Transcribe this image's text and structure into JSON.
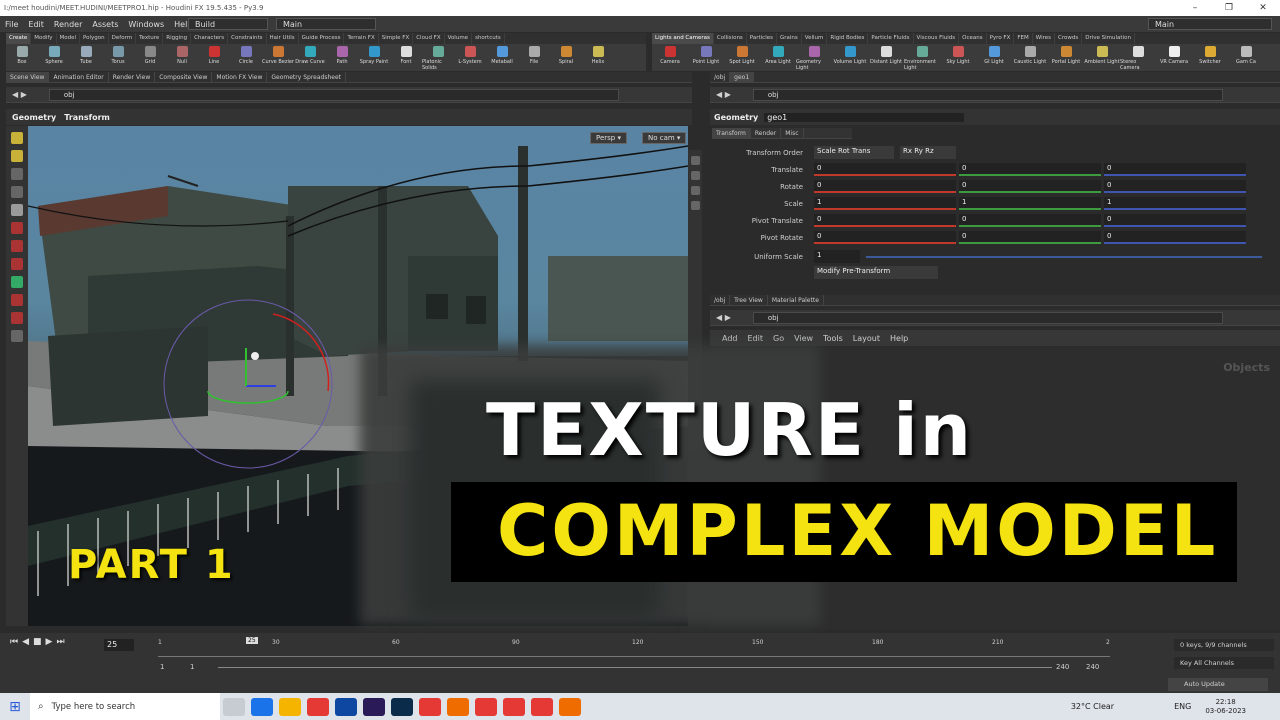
{
  "window": {
    "title": "I:/meet houdini/MEET.HUDINI/MEETPRO1.hip - Houdini FX 19.5.435 - Py3.9"
  },
  "menu": [
    "File",
    "Edit",
    "Render",
    "Assets",
    "Windows",
    "Help"
  ],
  "desktops": {
    "left": "Build",
    "middle": "Main",
    "right": "Main"
  },
  "shelf_tabs_left": [
    "Create",
    "Modify",
    "Model",
    "Polygon",
    "Deform",
    "Texture",
    "Rigging",
    "Characters",
    "Constraints",
    "Hair Utils",
    "Guide Process",
    "Terrain FX",
    "Simple FX",
    "Cloud FX",
    "Volume",
    "shortcuts"
  ],
  "shelf_tabs_right": [
    "Lights and Cameras",
    "Collisions",
    "Particles",
    "Grains",
    "Vellum",
    "Rigid Bodies",
    "Particle Fluids",
    "Viscous Fluids",
    "Oceans",
    "Pyro FX",
    "FEM",
    "Wires",
    "Crowds",
    "Drive Simulation"
  ],
  "tools_left": [
    "Box",
    "Sphere",
    "Tube",
    "Torus",
    "Grid",
    "Null",
    "Line",
    "Circle",
    "Curve Bezier",
    "Draw Curve",
    "Path",
    "Spray Paint",
    "Font",
    "Platonic Solids",
    "L-System",
    "Metaball",
    "File",
    "Spiral",
    "Helix"
  ],
  "tools_right": [
    "Camera",
    "Point Light",
    "Spot Light",
    "Area Light",
    "Geometry Light",
    "Volume Light",
    "Distant Light",
    "Environment Light",
    "Sky Light",
    "GI Light",
    "Caustic Light",
    "Portal Light",
    "Ambient Light",
    "Stereo Camera",
    "VR Camera",
    "Switcher",
    "Gam Ca"
  ],
  "left_pane_tabs": [
    "Scene View",
    "Animation Editor",
    "Render View",
    "Composite View",
    "Motion FX View",
    "Geometry Spreadsheet"
  ],
  "left_path": "obj",
  "viewer_header": {
    "ctx": "Geometry",
    "tool": "Transform"
  },
  "viewport_buttons": {
    "persp": "Persp ▾",
    "cam": "No cam ▾"
  },
  "right_top_tabs": [
    "/obj",
    "geo1"
  ],
  "right_path": "obj",
  "node": {
    "type": "Geometry",
    "name": "geo1"
  },
  "param_tabs": [
    "Transform",
    "Render",
    "Misc"
  ],
  "transform_order": {
    "label": "Transform Order",
    "order": "Scale Rot Trans",
    "rot": "Rx Ry Rz"
  },
  "params": [
    {
      "label": "Translate",
      "x": "0",
      "y": "0",
      "z": "0"
    },
    {
      "label": "Rotate",
      "x": "0",
      "y": "0",
      "z": "0"
    },
    {
      "label": "Scale",
      "x": "1",
      "y": "1",
      "z": "1"
    },
    {
      "label": "Pivot Translate",
      "x": "0",
      "y": "0",
      "z": "0"
    },
    {
      "label": "Pivot Rotate",
      "x": "0",
      "y": "0",
      "z": "0"
    }
  ],
  "uniform_scale": {
    "label": "Uniform Scale",
    "value": "1"
  },
  "modify_pre": "Modify Pre-Transform",
  "net_tabs": [
    "/obj",
    "Tree View",
    "Material Palette"
  ],
  "net_path": "obj",
  "net_menu": [
    "Add",
    "Edit",
    "Go",
    "View",
    "Tools",
    "Layout",
    "Help"
  ],
  "net_watermark": "Objects",
  "overlay": {
    "line1": "TEXTURE in",
    "line2": "COMPLEX MODEL",
    "part": "PART 1"
  },
  "timeline": {
    "frame": "25",
    "ticks": [
      "1",
      "30",
      "60",
      "90",
      "120",
      "150",
      "180",
      "210",
      "2"
    ],
    "start": "1",
    "start2": "1",
    "end": "240",
    "end2": "240",
    "keys": "0 keys, 9/9 channels",
    "keyall": "Key All Channels",
    "auto": "Auto Update",
    "current": "25"
  },
  "taskbar": {
    "search": "Type here to search",
    "weather": "32°C  Clear",
    "lang": "ENG",
    "time": "22:18",
    "date": "03-06-2023"
  },
  "colors": {
    "accent": "#f4e211",
    "x": "#c0392b",
    "y": "#3e9a3e",
    "z": "#3f55b0"
  }
}
